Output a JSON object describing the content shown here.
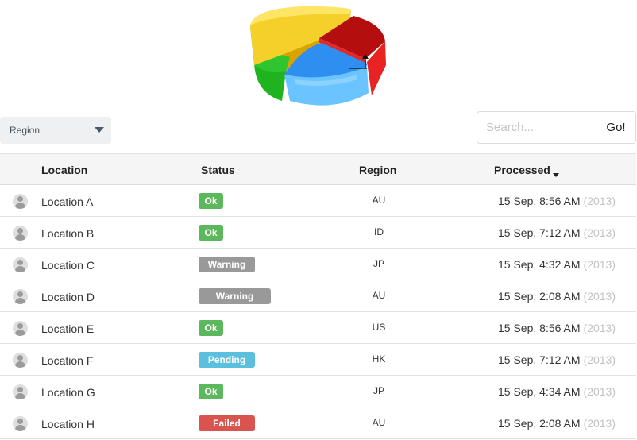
{
  "region_filter": {
    "label": "Region"
  },
  "search": {
    "placeholder": "Search...",
    "go_label": "Go!"
  },
  "table": {
    "columns": {
      "location": "Location",
      "status": "Status",
      "region": "Region",
      "processed": "Processed"
    },
    "rows": [
      {
        "location": "Location A",
        "status": "Ok",
        "status_type": "ok",
        "region": "AU",
        "time": "15 Sep, 8:56 AM",
        "year": "(2013)"
      },
      {
        "location": "Location B",
        "status": "Ok",
        "status_type": "ok",
        "region": "ID",
        "time": "15 Sep, 7:12 AM",
        "year": "(2013)"
      },
      {
        "location": "Location C",
        "status": "Warning",
        "status_type": "warning",
        "region": "JP",
        "time": "15 Sep, 4:32 AM",
        "year": "(2013)"
      },
      {
        "location": "Location D",
        "status": "Warning",
        "status_type": "warning",
        "region": "AU",
        "time": "15 Sep, 2:08 AM",
        "year": "(2013)"
      },
      {
        "location": "Location E",
        "status": "Ok",
        "status_type": "ok",
        "region": "US",
        "time": "15 Sep, 8:56 AM",
        "year": "(2013)"
      },
      {
        "location": "Location F",
        "status": "Pending",
        "status_type": "pending",
        "region": "HK",
        "time": "15 Sep, 7:12 AM",
        "year": "(2013)"
      },
      {
        "location": "Location G",
        "status": "Ok",
        "status_type": "ok",
        "region": "JP",
        "time": "15 Sep, 4:34 AM",
        "year": "(2013)"
      },
      {
        "location": "Location H",
        "status": "Failed",
        "status_type": "failed",
        "region": "AU",
        "time": "15 Sep, 2:08 AM",
        "year": "(2013)"
      }
    ]
  },
  "status_colors": {
    "ok": "#5cb85c",
    "warning": "#999999",
    "pending": "#5bc0de",
    "failed": "#d9534f"
  },
  "icons": {
    "logo": "pie-chart-icon",
    "avatar": "user-avatar-icon",
    "dropdown": "caret-down-icon",
    "sort": "sort-caret-down-icon"
  }
}
